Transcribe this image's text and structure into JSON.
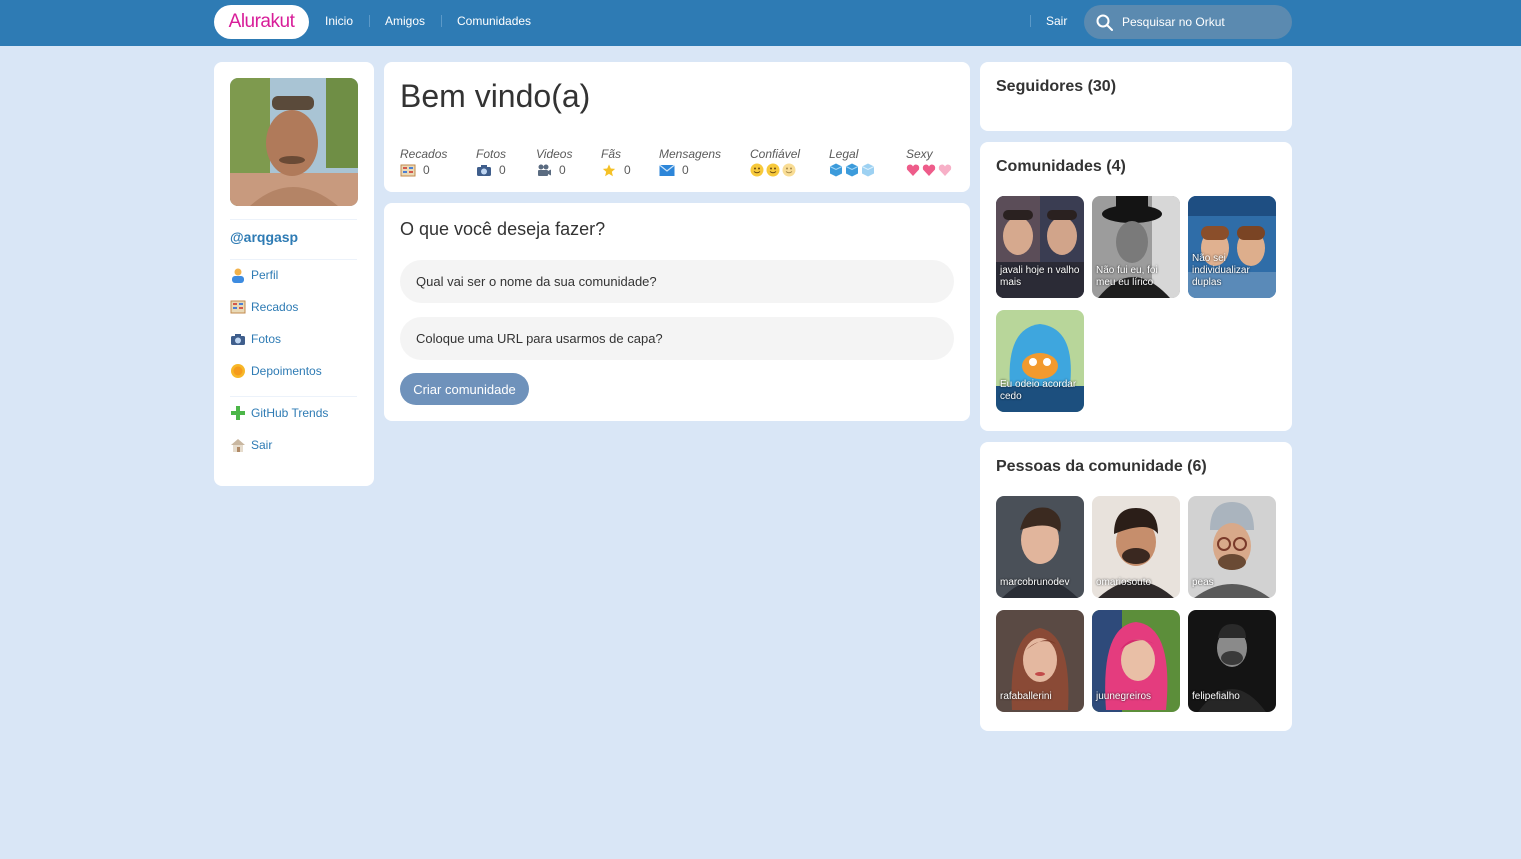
{
  "header": {
    "logo": "Alurakut",
    "nav": [
      "Inicio",
      "Amigos",
      "Comunidades"
    ],
    "logout": "Sair",
    "search_placeholder": "Pesquisar no Orkut"
  },
  "profile": {
    "username": "@arqgasp",
    "menu": [
      {
        "label": "Perfil",
        "icon": "user-icon"
      },
      {
        "label": "Recados",
        "icon": "book-icon"
      },
      {
        "label": "Fotos",
        "icon": "camera-icon"
      },
      {
        "label": "Depoimentos",
        "icon": "sun-icon"
      },
      {
        "label": "GitHub Trends",
        "icon": "plus-icon"
      },
      {
        "label": "Sair",
        "icon": "house-icon"
      }
    ]
  },
  "welcome": {
    "title": "Bem vindo(a)",
    "stats": [
      {
        "label": "Recados",
        "value": "0",
        "icon": "book-icon"
      },
      {
        "label": "Fotos",
        "value": "0",
        "icon": "camera-icon"
      },
      {
        "label": "Videos",
        "value": "0",
        "icon": "video-camera-icon"
      },
      {
        "label": "Fãs",
        "value": "0",
        "icon": "star-icon"
      },
      {
        "label": "Mensagens",
        "value": "0",
        "icon": "envelope-icon"
      },
      {
        "label": "Confiável",
        "icon": "smiley-icon"
      },
      {
        "label": "Legal",
        "icon": "ice-cube-icon"
      },
      {
        "label": "Sexy",
        "icon": "heart-icon"
      }
    ]
  },
  "form": {
    "title": "O que você deseja fazer?",
    "name_placeholder": "Qual vai ser o nome da sua comunidade?",
    "url_placeholder": "Coloque uma URL para usarmos de capa?",
    "submit": "Criar comunidade"
  },
  "followers": {
    "title": "Seguidores (30)"
  },
  "communities": {
    "title": "Comunidades (4)",
    "items": [
      "javali hoje n valho mais",
      "Não fui eu, foi meu eu lírico",
      "Não sei individualizar duplas",
      "Eu odeio acordar cedo"
    ]
  },
  "people": {
    "title": "Pessoas da comunidade (6)",
    "items": [
      "marcobrunodev",
      "omariosouto",
      "peas",
      "rafaballerini",
      "juunegreiros",
      "felipefialho"
    ]
  },
  "colors": {
    "topbar": "#2E7BB4",
    "background": "#D9E6F6",
    "logo": "#D81D99",
    "link": "#2E7BB4",
    "button": "#6F92BB"
  }
}
